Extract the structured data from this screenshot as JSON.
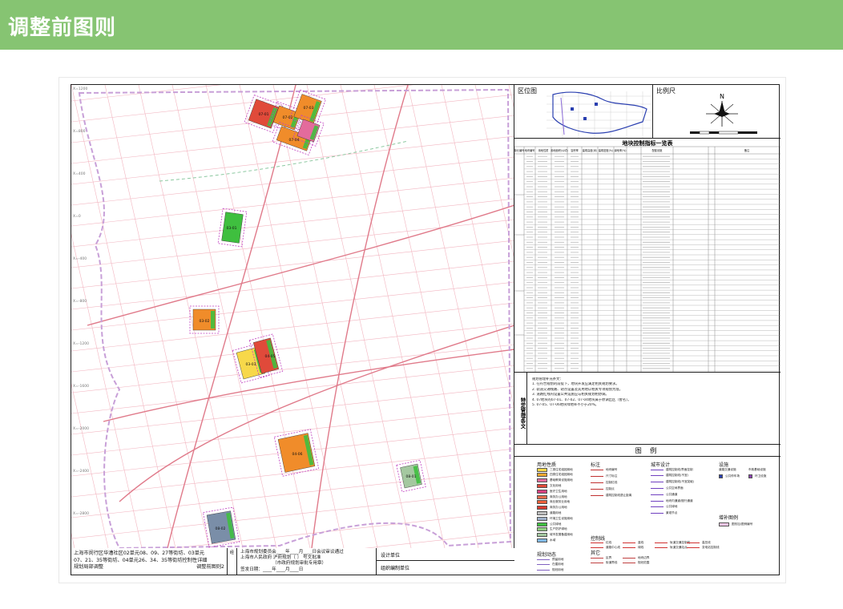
{
  "header": {
    "title": "调整前图则",
    "band_color": "#86c472"
  },
  "map": {
    "axis_labels_left": [
      "X=1200",
      "X=800",
      "X=400",
      "X=0",
      "X=-400",
      "X=-800",
      "X=-1200",
      "X=-1600",
      "X=-2000",
      "X=-2400",
      "X=-2800"
    ],
    "colors": {
      "residential": "#f08c2a",
      "commercial": "#e04a3a",
      "green": "#3fbf3f",
      "public": "#2a5fc8",
      "road_red": "#e07a8a",
      "boundary": "#c8a0d8"
    },
    "parcel_labels": [
      "07-01",
      "07-02",
      "07-03",
      "07-04",
      "03-01",
      "03-02",
      "03-03",
      "04-05",
      "04-06",
      "08-01",
      "08-02"
    ]
  },
  "location_map": {
    "label": "区位图"
  },
  "scale": {
    "label": "比例尺",
    "north_label": "N"
  },
  "indicator_table": {
    "title": "地块控制指标一览表",
    "headers": [
      "单元编号",
      "地块编号",
      "用地性质",
      "用地面积(公顷)",
      "容积率",
      "建筑高度(米)",
      "建筑密度(%)",
      "绿地率(%)",
      "配套设施",
      "备注"
    ]
  },
  "special_provisions": {
    "side_label": "特定管理条文",
    "lines": [
      "规划管理补充条文：",
      "1. 在符合规划的前提下，地块开发应满足相关规划要求。",
      "2. 轨道交通线路、站点设置及其用地以相关专项规划为准。",
      "3. 道路红线内设置公共设施应与相关规划相协调。",
      "",
      "4. 07地块的07-01、07-02、07-04地块属于原调出区（暂名）。",
      "5. 07-05、07-06地块绿地率不小于20%。"
    ]
  },
  "legend": {
    "title": "图 例",
    "land_use_head": "用地性质",
    "land_use": [
      {
        "label": "三类住宅组团用地",
        "color": "#f7d84a"
      },
      {
        "label": "四类住宅组团用地",
        "color": "#f0a830"
      },
      {
        "label": "基础教育设施用地",
        "color": "#e36b9c"
      },
      {
        "label": "文化用地",
        "color": "#e04a3a"
      },
      {
        "label": "医疗卫生用地",
        "color": "#d94080"
      },
      {
        "label": "商务办公用地",
        "color": "#e66a4a"
      },
      {
        "label": "商业服务业用地",
        "color": "#f0603a"
      },
      {
        "label": "商务办公用地",
        "color": "#d93a30"
      },
      {
        "label": "道路用地",
        "color": "#bfbfbf"
      },
      {
        "label": "环境卫生设施用地",
        "color": "#9fb0c8"
      },
      {
        "label": "公共绿地",
        "color": "#3fbf3f"
      },
      {
        "label": "生产防护绿地",
        "color": "#8fd07f"
      },
      {
        "label": "城市发展备建用地",
        "color": "#a4c8a0"
      },
      {
        "label": "水域",
        "color": "#7fb8e8"
      }
    ],
    "marks_head": "标注",
    "marks": [
      "地块编号",
      "尺寸标注",
      "控制红线",
      "控制点",
      "建筑控制线退让距离"
    ],
    "urban_design_head": "城市设计",
    "urban_design": [
      "建筑控制线/界面控制",
      "建筑控制线(不宜)",
      "建筑控制线(不宜突破)",
      "公共空间界面",
      "公共通道",
      "地块内通道/慢行通道",
      "公共绿地",
      "景观节点"
    ],
    "control_lines_head": "控制线",
    "control_lines": [
      "红线",
      "道路中心线",
      "蓝线",
      "绿线",
      "轨道交通控制线",
      "轨道交通站点",
      "高压线",
      "变电站控制线"
    ],
    "facility_head": "设施",
    "facility_road_head": "道路交通设施",
    "facility_municipal_head": "市政基础设施",
    "facilities": [
      {
        "label": "公共停车场"
      },
      {
        "label": "环卫设施"
      }
    ],
    "supplement_head": "增补图例",
    "supplement": [
      "图形加/图例编号"
    ],
    "planning_head": "规划动态",
    "planning": [
      "预留用地",
      "在建用地",
      "规划用地"
    ],
    "other_head": "其它",
    "other": [
      "区界",
      "街道界线",
      "地块边界",
      "规划范围"
    ]
  },
  "title_block": {
    "project_lines": [
      "上海市闵行区华漕社区02单元08、09、27等街坊、03单元",
      "07、21、35等街坊、04单元26、34、35等街坊控制性详细",
      "规划局部调整"
    ],
    "sheet_name": "调整前图则2",
    "stamp": "经",
    "approval_lines": [
      "上海市规划委员会____年____月____日会议审议通过",
      "上海市人民政府        沪府规划〔      〕        号文批准",
      "                     （市政府规划审批专用章）",
      "签发日期：____年____月____日"
    ],
    "design_unit": "设计单位",
    "editing_unit": "组织编制单位"
  }
}
